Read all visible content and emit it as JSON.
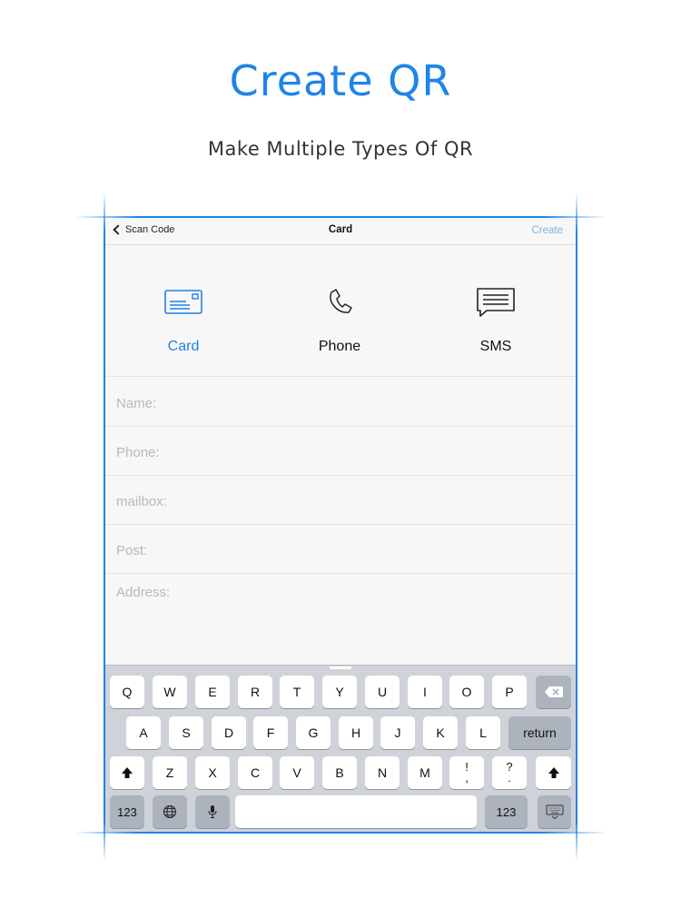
{
  "page": {
    "headline": "Create QR",
    "subheadline": "Make Multiple Types Of QR"
  },
  "colors": {
    "accent": "#1f84e6",
    "accent_light": "#7eb3e6",
    "keyboard_bg": "#cfd3d9",
    "placeholder": "#b8b8b8"
  },
  "navbar": {
    "back_label": "Scan Code",
    "title": "Card",
    "action_label": "Create"
  },
  "types": [
    {
      "label": "Card",
      "icon": "card-icon",
      "active": true
    },
    {
      "label": "Phone",
      "icon": "phone-icon",
      "active": false
    },
    {
      "label": "SMS",
      "icon": "sms-icon",
      "active": false
    }
  ],
  "form": {
    "name_placeholder": "Name:",
    "phone_placeholder": "Phone:",
    "mailbox_placeholder": "mailbox:",
    "post_placeholder": "Post:",
    "address_placeholder": "Address:"
  },
  "keyboard": {
    "row1": [
      "Q",
      "W",
      "E",
      "R",
      "T",
      "Y",
      "U",
      "I",
      "O",
      "P"
    ],
    "row2": [
      "A",
      "S",
      "D",
      "F",
      "G",
      "H",
      "J",
      "K",
      "L"
    ],
    "row3": [
      "Z",
      "X",
      "C",
      "V",
      "B",
      "N",
      "M"
    ],
    "return_label": "return",
    "numbers_label": "123",
    "punct1_top": "!",
    "punct1_bottom": ",",
    "punct2_top": "?",
    "punct2_bottom": ".",
    "icons": [
      "backspace-icon",
      "shift-icon",
      "globe-icon",
      "microphone-icon",
      "keyboard-dismiss-icon"
    ]
  }
}
